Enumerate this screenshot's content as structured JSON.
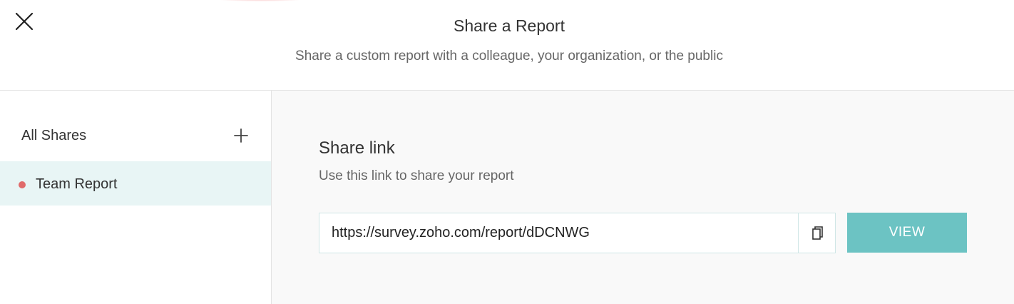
{
  "header": {
    "title": "Share a Report",
    "subtitle": "Share a custom report with a colleague, your organization, or the public",
    "close_icon": "close-icon"
  },
  "sidebar": {
    "heading": "All Shares",
    "add_icon": "plus-icon",
    "items": [
      {
        "label": "Team Report",
        "status_color": "#e06b6b",
        "selected": true
      }
    ]
  },
  "main": {
    "section_title": "Share link",
    "section_description": "Use this link to share your report",
    "link_value": "https://survey.zoho.com/report/dDCNWG",
    "copy_icon": "copy-icon",
    "view_button_label": "VIEW"
  },
  "colors": {
    "accent": "#6cc3c3",
    "selected_bg": "#e8f5f5",
    "status_dot": "#e06b6b"
  }
}
